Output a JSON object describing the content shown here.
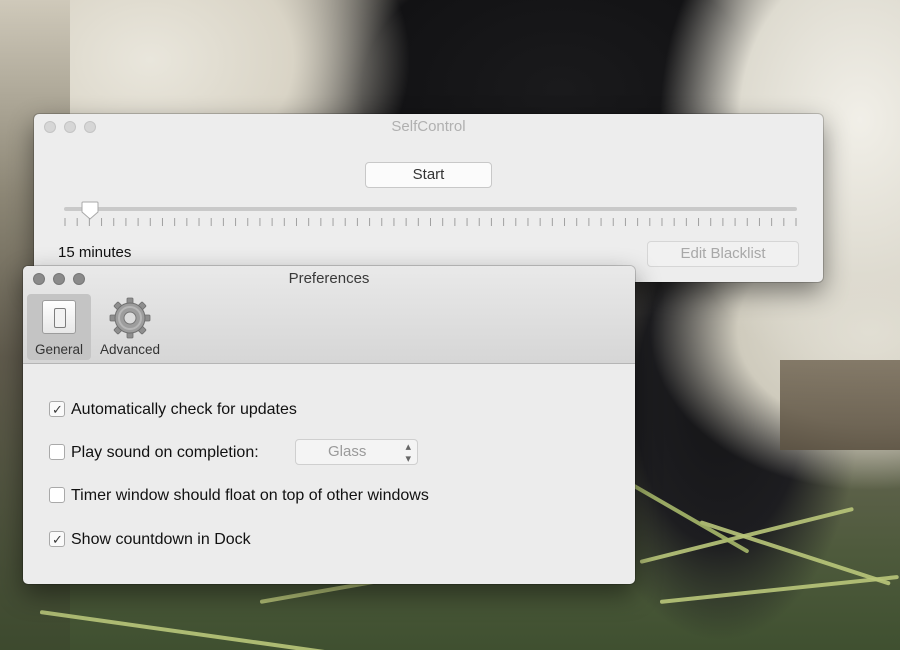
{
  "selfcontrol_window": {
    "title": "SelfControl",
    "start_label": "Start",
    "duration_label": "15 minutes",
    "duration_slider_fraction": 0.02,
    "edit_blacklist_label": "Edit Blacklist"
  },
  "preferences_window": {
    "title": "Preferences",
    "tabs": [
      {
        "label": "General",
        "icon": "switch-icon",
        "selected": true
      },
      {
        "label": "Advanced",
        "icon": "gear-icon",
        "selected": false
      }
    ],
    "options": [
      {
        "label": "Automatically check for updates",
        "checked": true
      },
      {
        "label": "Play sound on completion:",
        "checked": false
      },
      {
        "label": "Timer window should float on top of other windows",
        "checked": false
      },
      {
        "label": "Show countdown in Dock",
        "checked": true
      }
    ],
    "sound_popup": {
      "selected": "Glass"
    }
  },
  "colors": {
    "window_bg": "#ececec",
    "disabled_text": "#a8a8a8",
    "inactive_title": "#b0b0b0"
  }
}
